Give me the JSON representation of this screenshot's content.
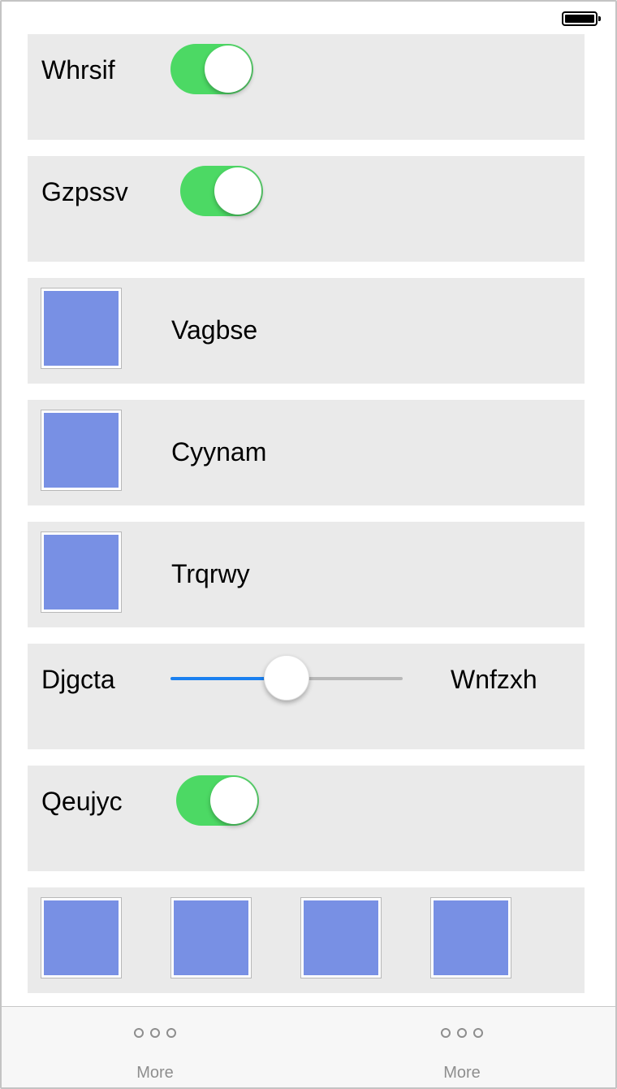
{
  "status_bar": {
    "battery_icon": "battery-full-icon"
  },
  "cells": {
    "whrsif": {
      "label": "Whrsif",
      "toggle_on": true
    },
    "gzpssv": {
      "label": "Gzpssv",
      "toggle_on": true
    },
    "vagbse": {
      "label": "Vagbse",
      "swatch_color": "#7890e4"
    },
    "cyynam": {
      "label": "Cyynam",
      "swatch_color": "#7890e4"
    },
    "trqrwy": {
      "label": "Trqrwy",
      "swatch_color": "#7890e4"
    },
    "djgcta": {
      "left_label": "Djgcta",
      "right_label": "Wnfzxh",
      "slider_value": 0.5
    },
    "qeujyc": {
      "label": "Qeujyc",
      "toggle_on": true
    },
    "swatch_row": {
      "swatch_colors": [
        "#7890e4",
        "#7890e4",
        "#7890e4",
        "#7890e4"
      ]
    }
  },
  "tab_bar": {
    "tabs": [
      {
        "label": "More",
        "icon": "more-dots-icon"
      },
      {
        "label": "More",
        "icon": "more-dots-icon"
      }
    ]
  },
  "colors": {
    "toggle_on": "#4cd964",
    "slider_fill": "#1a80f0",
    "swatch": "#7890e4",
    "cell_background": "#eaeaea"
  }
}
